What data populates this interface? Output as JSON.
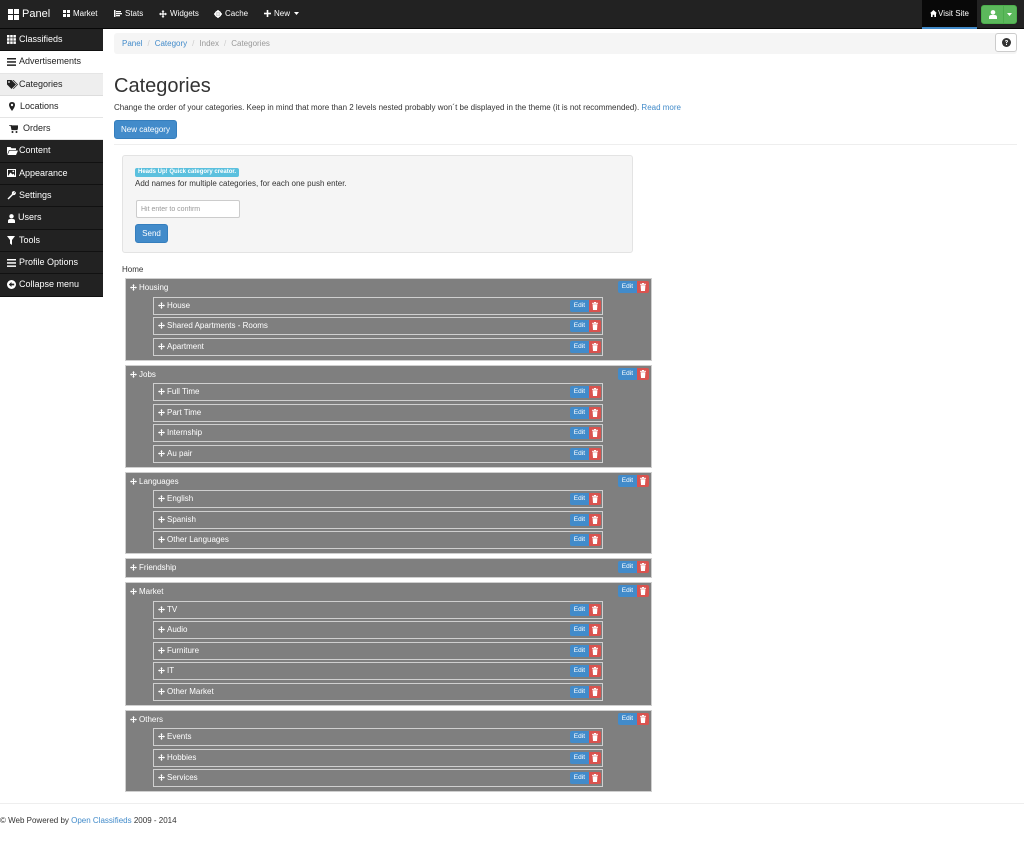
{
  "navbar": {
    "brand": "Panel",
    "items": [
      {
        "label": "Market",
        "icon": "grid-icon"
      },
      {
        "label": "Stats",
        "icon": "bar-chart-icon"
      },
      {
        "label": "Widgets",
        "icon": "move-icon"
      },
      {
        "label": "Cache",
        "icon": "gear-icon"
      },
      {
        "label": "New",
        "icon": "plus-icon"
      }
    ],
    "visit_site": "Visit Site"
  },
  "sidebar": {
    "items": [
      {
        "label": "Classifieds",
        "icon": "grid-icon"
      },
      {
        "label": "Advertisements",
        "icon": "list-icon"
      },
      {
        "label": "Categories",
        "icon": "tags-icon"
      },
      {
        "label": "Locations",
        "icon": "map-marker-icon"
      },
      {
        "label": "Orders",
        "icon": "cart-icon"
      },
      {
        "label": "Content",
        "icon": "folder-open-icon"
      },
      {
        "label": "Appearance",
        "icon": "picture-icon"
      },
      {
        "label": "Settings",
        "icon": "wrench-icon"
      },
      {
        "label": "Users",
        "icon": "user-icon"
      },
      {
        "label": "Tools",
        "icon": "filter-icon"
      },
      {
        "label": "Profile Options",
        "icon": "list-icon"
      },
      {
        "label": "Collapse menu",
        "icon": "circle-arrow-left-icon"
      }
    ]
  },
  "breadcrumb": {
    "items": [
      "Panel",
      "Category",
      "Index",
      "Categories"
    ]
  },
  "page": {
    "title": "Categories",
    "intro": "Change the order of your categories. Keep in mind that more than 2 levels nested probably won´t be displayed in the theme (it is not recommended).",
    "read_more": "Read more",
    "new_category": "New category"
  },
  "quick_creator": {
    "badge": "Heads Up! Quick category creator.",
    "text": "Add names for multiple categories, for each one push enter.",
    "placeholder": "Hit enter to confirm",
    "send": "Send"
  },
  "tree": {
    "root": "Home",
    "edit_label": "Edit",
    "categories": [
      {
        "name": "Housing",
        "children": [
          "House",
          "Shared Apartments - Rooms",
          "Apartment"
        ]
      },
      {
        "name": "Jobs",
        "children": [
          "Full Time",
          "Part Time",
          "Internship",
          "Au pair"
        ]
      },
      {
        "name": "Languages",
        "children": [
          "English",
          "Spanish",
          "Other Languages"
        ]
      },
      {
        "name": "Friendship",
        "children": []
      },
      {
        "name": "Market",
        "children": [
          "TV",
          "Audio",
          "Furniture",
          "IT",
          "Other Market"
        ]
      },
      {
        "name": "Others",
        "children": [
          "Events",
          "Hobbies",
          "Services"
        ]
      }
    ]
  },
  "footer": {
    "prefix": "© Web Powered by",
    "link": "Open Classifieds",
    "suffix": "2009 - 2014"
  }
}
